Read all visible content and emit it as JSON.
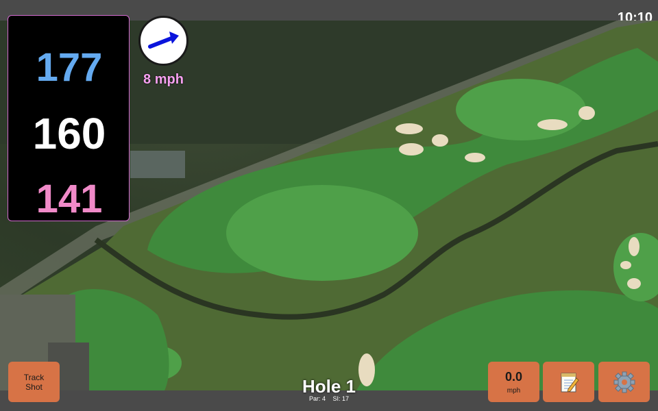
{
  "status": {
    "time": "10:10"
  },
  "distances": {
    "back": "177",
    "center": "160",
    "front": "141"
  },
  "wind": {
    "speed_label": "8 mph",
    "arrow_icon": "arrow-right-icon",
    "arrow_color": "#0a14dc"
  },
  "hole": {
    "title": "Hole 1",
    "par": "Par: 4",
    "si": "SI: 17"
  },
  "buttons": {
    "track_shot": {
      "line1": "Track",
      "line2": "Shot"
    },
    "wind_readout": {
      "value": "0.0",
      "unit": "mph"
    },
    "notes": {
      "icon": "notepad-icon"
    },
    "settings": {
      "icon": "gear-icon"
    }
  },
  "colors": {
    "button_bg": "#d77346",
    "back_distance": "#64aaf0",
    "center_distance": "#ffffff",
    "front_distance": "#f08ac8",
    "wind_label": "#f6a0f0"
  }
}
